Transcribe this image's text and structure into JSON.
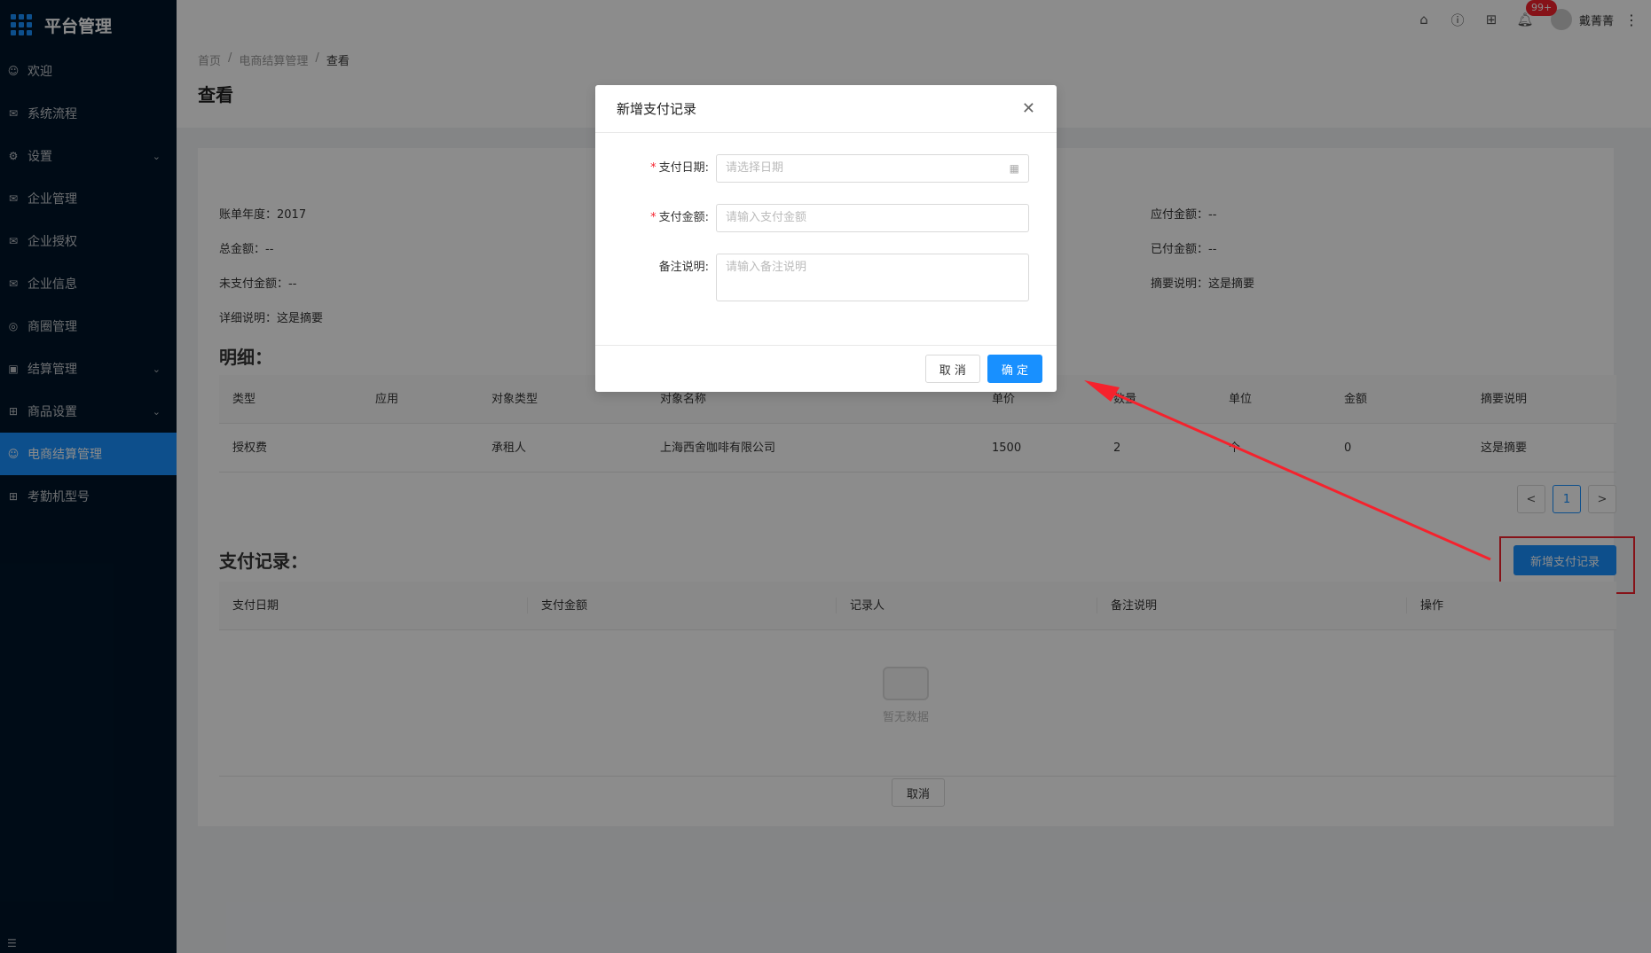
{
  "app": {
    "title": "平台管理"
  },
  "sidebar": {
    "items": [
      {
        "label": "欢迎",
        "icon": "smile-icon",
        "arrow": ""
      },
      {
        "label": "系统流程",
        "icon": "mail-icon",
        "arrow": ""
      },
      {
        "label": "设置",
        "icon": "gear-icon",
        "arrow": "⌄"
      },
      {
        "label": "企业管理",
        "icon": "mail-icon",
        "arrow": ""
      },
      {
        "label": "企业授权",
        "icon": "mail-icon",
        "arrow": ""
      },
      {
        "label": "企业信息",
        "icon": "mail-icon",
        "arrow": ""
      },
      {
        "label": "商圈管理",
        "icon": "compass-icon",
        "arrow": ""
      },
      {
        "label": "结算管理",
        "icon": "calendar-icon",
        "arrow": "⌄"
      },
      {
        "label": "商品设置",
        "icon": "appstore-icon",
        "arrow": "⌄"
      },
      {
        "label": "电商结算管理",
        "icon": "smile-icon",
        "arrow": ""
      },
      {
        "label": "考勤机型号",
        "icon": "appstore-icon",
        "arrow": ""
      }
    ],
    "active_index": 9
  },
  "header": {
    "badge": "99+",
    "user_name": "戴菁菁"
  },
  "breadcrumb": {
    "home": "首页",
    "parent": "电商结算管理",
    "current": "查看"
  },
  "page": {
    "title": "查看"
  },
  "info": {
    "bill_year": "账单年度：2017",
    "total_amount": "总金额：--",
    "unpaid_amount": "未支付金额：--",
    "detail_desc": "详细说明：这是摘要",
    "payable_amount": "应付金额：--",
    "paid_amount": "已付金额：--",
    "summary_desc": "摘要说明：这是摘要"
  },
  "detail": {
    "title": "明细：",
    "columns": [
      "类型",
      "应用",
      "对象类型",
      "对象名称",
      "单价",
      "数量",
      "单位",
      "金额",
      "摘要说明"
    ],
    "rows": [
      [
        "授权费",
        "",
        "承租人",
        "上海西舍咖啡有限公司",
        "1500",
        "2",
        "个",
        "0",
        "这是摘要"
      ]
    ]
  },
  "pagination": {
    "prev": "<",
    "page": "1",
    "next": ">"
  },
  "payment": {
    "title": "支付记录：",
    "add_label": "新增支付记录",
    "columns": [
      "支付日期",
      "支付金额",
      "记录人",
      "备注说明",
      "操作"
    ],
    "empty_text": "暂无数据",
    "cancel_label": "取消"
  },
  "modal": {
    "title": "新增支付记录",
    "date_label": "支付日期:",
    "date_placeholder": "请选择日期",
    "amount_label": "支付金额:",
    "amount_placeholder": "请输入支付金额",
    "remark_label": "备注说明:",
    "remark_placeholder": "请输入备注说明",
    "cancel_label": "取 消",
    "ok_label": "确 定"
  },
  "colors": {
    "primary": "#1890ff",
    "sidebar": "#001529",
    "annotation": "#f5222d"
  }
}
